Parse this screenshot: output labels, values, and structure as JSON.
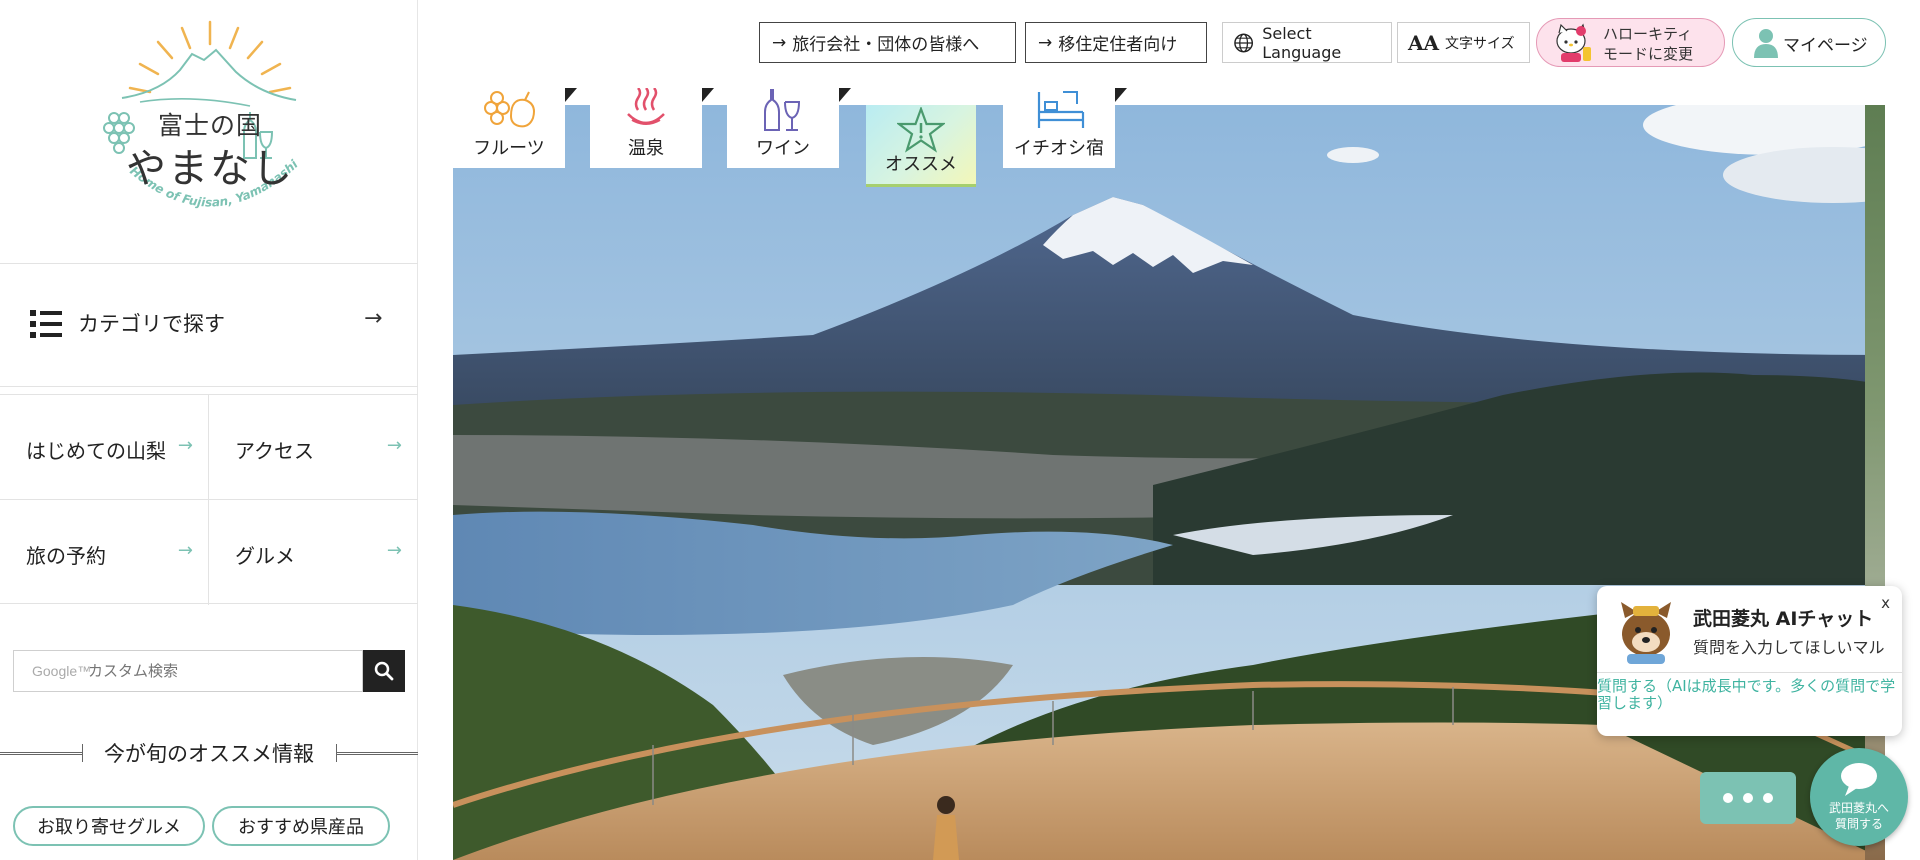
{
  "logo": {
    "line1": "富士の国",
    "line2": "やまなし",
    "tagline": "Home of Fujisan, Yamanashi"
  },
  "sidebar": {
    "category_label": "カテゴリで探す",
    "nav": [
      {
        "label": "はじめての山梨"
      },
      {
        "label": "アクセス"
      },
      {
        "label": "旅の予約"
      },
      {
        "label": "グルメ"
      }
    ],
    "search_placeholder": "カスタム検索",
    "search_brand": "Google™",
    "season_title": "今が旬のオススメ情報",
    "pills": [
      "お取り寄せグルメ",
      "おすすめ県産品"
    ]
  },
  "topbar": {
    "agency": "旅行会社・団体の皆様へ",
    "migration": "移住定住者向け",
    "language": "Select Language",
    "text_size": "文字サイズ",
    "text_size_glyph": "AA",
    "kitty_line1": "ハローキティ",
    "kitty_line2": "モードに変更",
    "mypage": "マイページ"
  },
  "tabs": [
    {
      "label": "フルーツ",
      "icon": "fruit-icon"
    },
    {
      "label": "温泉",
      "icon": "hot-spring-icon"
    },
    {
      "label": "ワイン",
      "icon": "wine-icon"
    },
    {
      "label": "オススメ",
      "icon": "star-icon"
    },
    {
      "label": "イチオシ宿",
      "icon": "bed-icon"
    }
  ],
  "chat": {
    "name": "武田菱丸 AIチャット",
    "subtitle": "質問を入力してほしいマル",
    "close": "x",
    "ask": "質問する（AIは成長中です。多くの質問で学習します）",
    "bubble_line1": "武田菱丸へ",
    "bubble_line2": "質問する"
  },
  "colors": {
    "accent": "#7cc2b3",
    "kitty_bg": "#fde2ec",
    "chat_link": "#3fb3a0"
  }
}
